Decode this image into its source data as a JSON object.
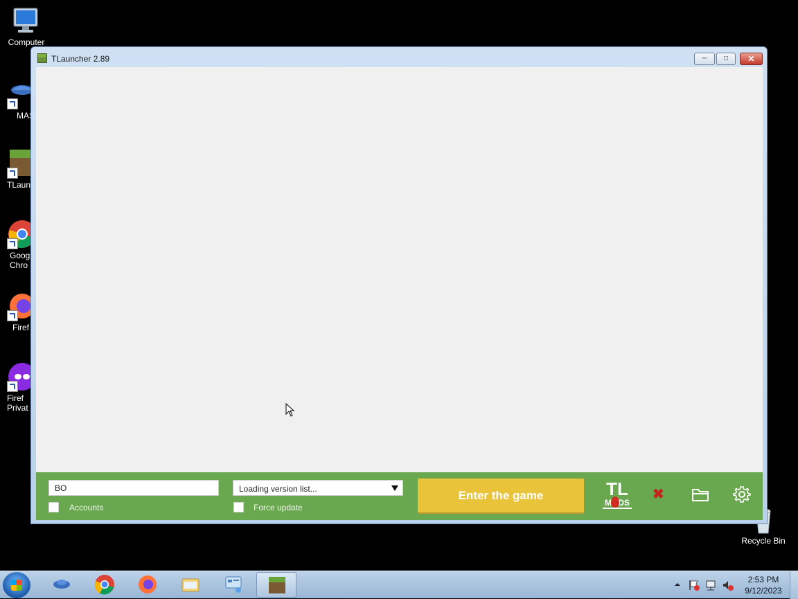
{
  "desktop": {
    "icons": [
      {
        "name": "Computer"
      },
      {
        "name": "MAS"
      },
      {
        "name": "TLaun"
      },
      {
        "name": "Goog Chro"
      },
      {
        "name": "Firef"
      },
      {
        "name": "Firef Privat"
      },
      {
        "name": "Recycle Bin"
      }
    ]
  },
  "window": {
    "title": "TLauncher 2.89",
    "controls": {
      "minimize": "─",
      "maximize": "□",
      "close": "✕"
    }
  },
  "launcher": {
    "username_value": "BO",
    "version_select": "Loading version list...",
    "accounts_label": "Accounts",
    "force_update_label": "Force update",
    "enter_button": "Enter the game",
    "mods_logo_top": "TL",
    "mods_logo_bottom": "MODS"
  },
  "taskbar": {
    "time": "2:53 PM",
    "date": "9/12/2023"
  },
  "colors": {
    "bar_green": "#6aa84f",
    "enter_yellow": "#e9c43a"
  }
}
